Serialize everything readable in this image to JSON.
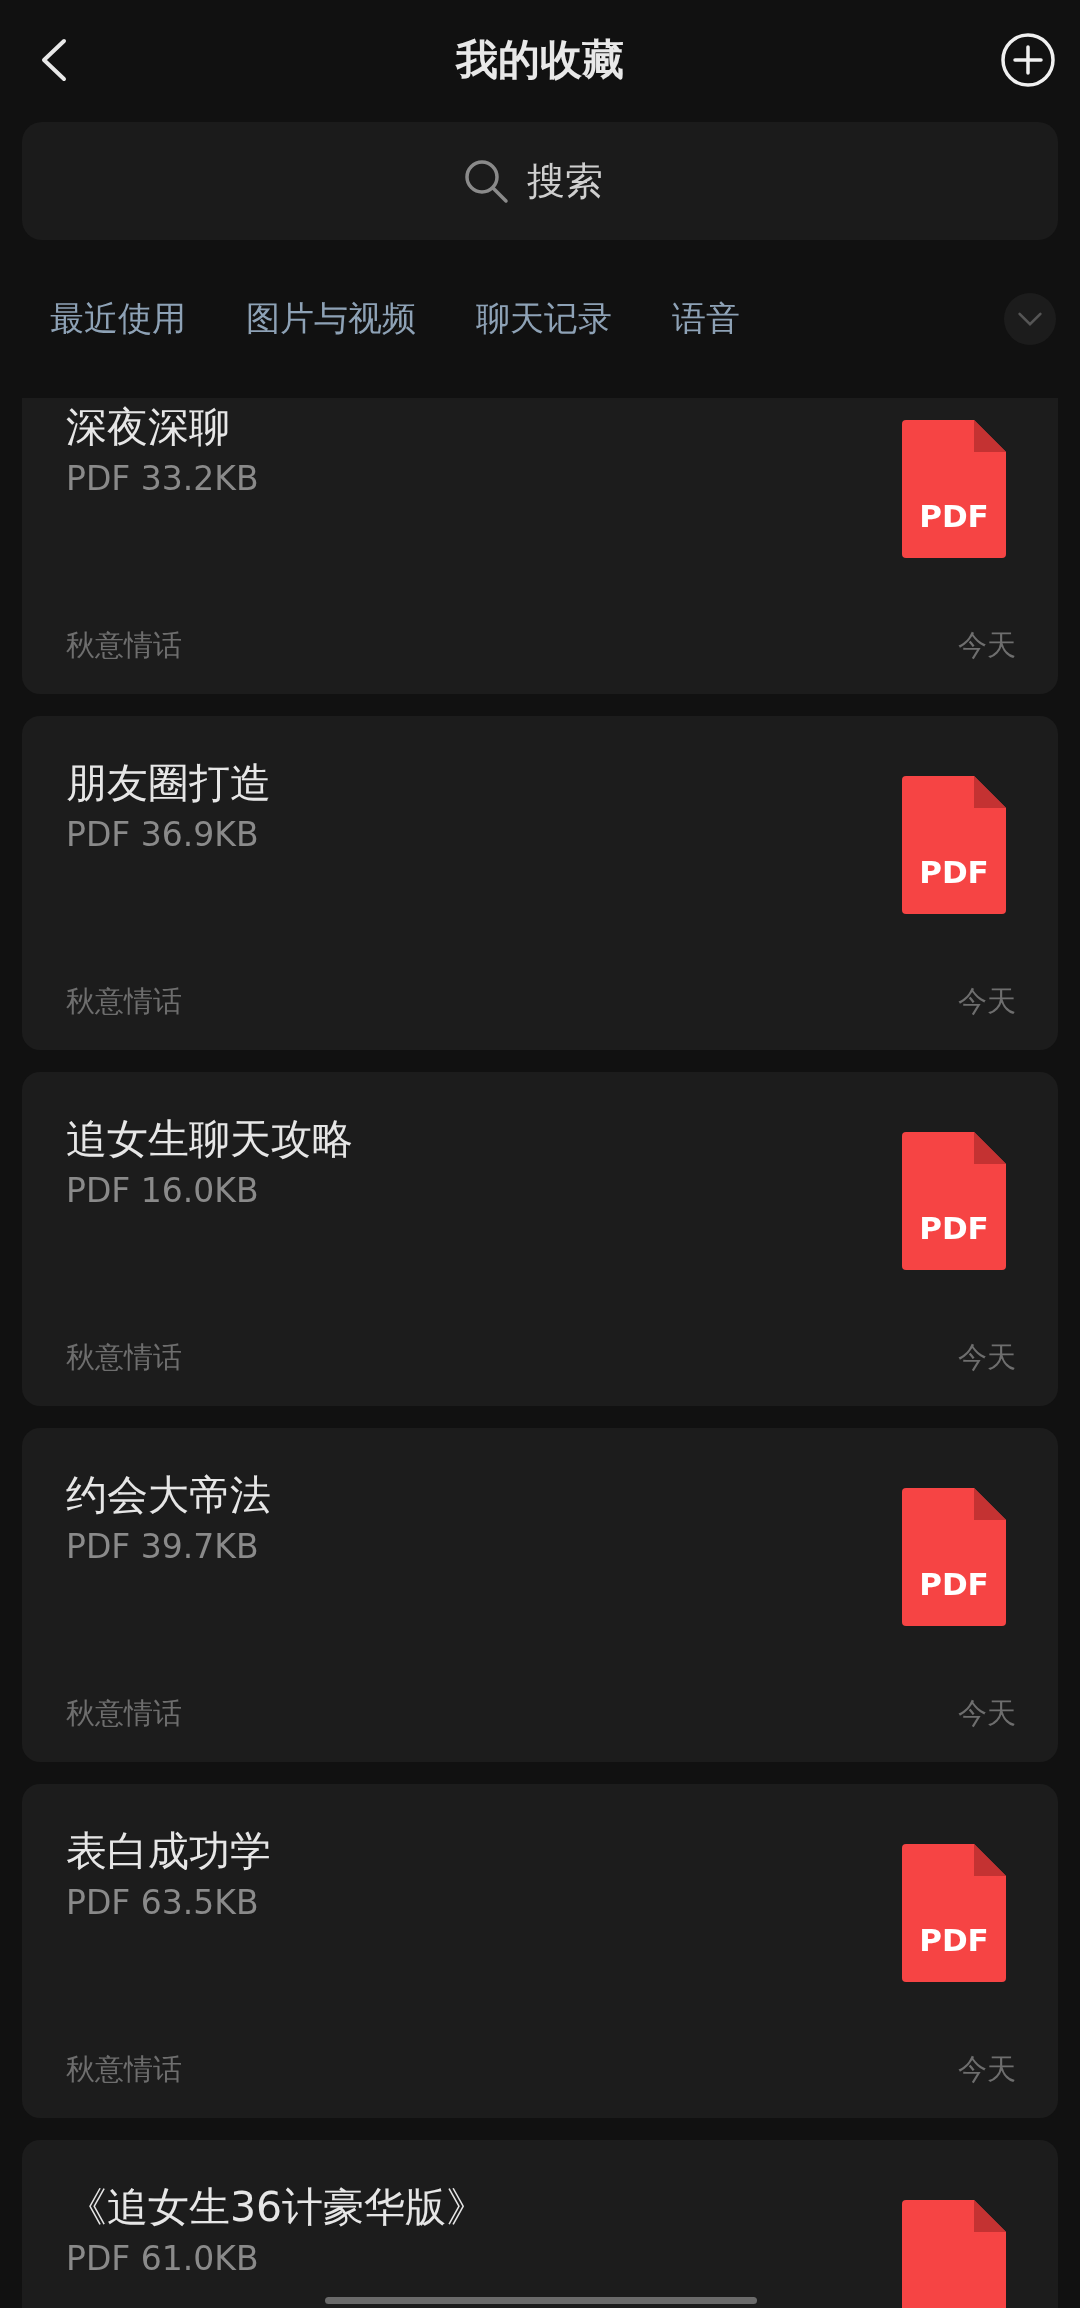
{
  "header": {
    "title": "我的收藏"
  },
  "search": {
    "placeholder": "搜索"
  },
  "tabs": [
    {
      "label": "最近使用"
    },
    {
      "label": "图片与视频"
    },
    {
      "label": "聊天记录"
    },
    {
      "label": "语音"
    }
  ],
  "items": [
    {
      "title": "深夜深聊",
      "size": "PDF 33.2KB",
      "icon_text": "PDF",
      "source": "秋意情话",
      "date": "今天"
    },
    {
      "title": "朋友圈打造",
      "size": "PDF 36.9KB",
      "icon_text": "PDF",
      "source": "秋意情话",
      "date": "今天"
    },
    {
      "title": "追女生聊天攻略",
      "size": "PDF 16.0KB",
      "icon_text": "PDF",
      "source": "秋意情话",
      "date": "今天"
    },
    {
      "title": "约会大帝法",
      "size": "PDF 39.7KB",
      "icon_text": "PDF",
      "source": "秋意情话",
      "date": "今天"
    },
    {
      "title": "表白成功学",
      "size": "PDF 63.5KB",
      "icon_text": "PDF",
      "source": "秋意情话",
      "date": "今天"
    },
    {
      "title": "《追女生36计豪华版》",
      "size": "PDF 61.0KB"
    }
  ]
}
